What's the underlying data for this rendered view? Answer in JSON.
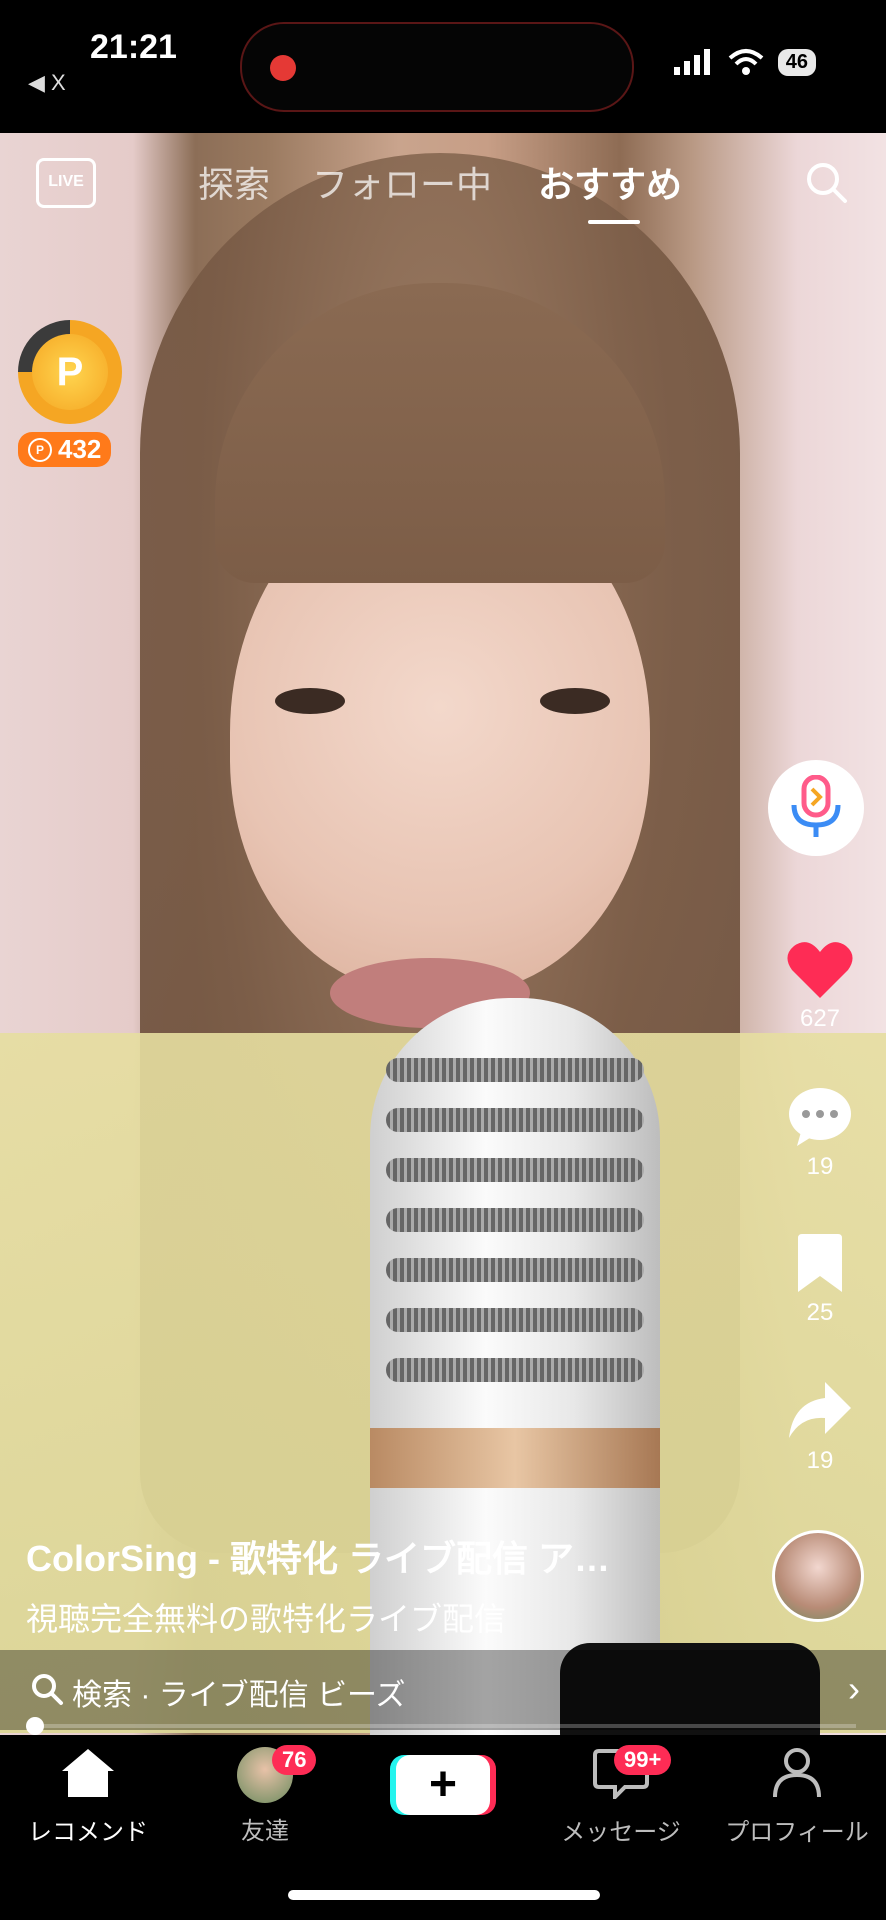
{
  "status_bar": {
    "time": "21:21",
    "back_label": "◀ X",
    "battery": "46"
  },
  "top_nav": {
    "live_label": "LIVE",
    "tabs": [
      "探索",
      "フォロー中",
      "おすすめ"
    ],
    "active_tab": "おすすめ"
  },
  "coin": {
    "symbol": "P",
    "points": "432",
    "progress_percent": 75
  },
  "rail": {
    "likes": "627",
    "comments": "19",
    "bookmarks": "25",
    "shares": "19"
  },
  "caption": {
    "title": "ColorSing - 歌特化 ライブ配信 ア…",
    "subtitle": "視聴完全無料の歌特化ライブ配信"
  },
  "search_bar": {
    "text": "検索 · ライブ配信 ビーズ"
  },
  "bottom_nav": {
    "items": [
      {
        "label": "レコメンド"
      },
      {
        "label": "友達",
        "badge": "76"
      },
      {
        "label": "+"
      },
      {
        "label": "メッセージ",
        "badge": "99+"
      },
      {
        "label": "プロフィール"
      }
    ]
  },
  "colors": {
    "accent_red": "#fe2c55",
    "accent_cyan": "#25f4ee",
    "coin_orange": "#f5a623"
  }
}
